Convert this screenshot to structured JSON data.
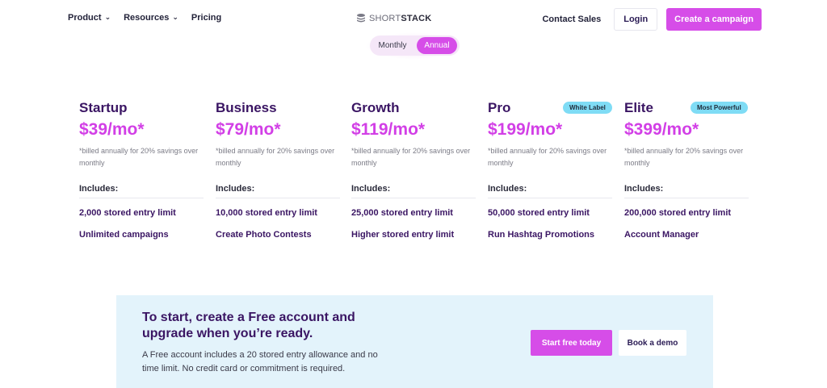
{
  "nav": {
    "left_links": [
      {
        "label": "Product",
        "dropdown": true
      },
      {
        "label": "Resources",
        "dropdown": true
      },
      {
        "label": "Pricing",
        "dropdown": false
      }
    ],
    "logo": {
      "part1": "SHORT",
      "part2": "STACK",
      "icon": "stack-logo-icon"
    },
    "contact_label": "Contact Sales",
    "login_label": "Login",
    "create_label": "Create a campaign"
  },
  "billing_toggle": {
    "options": [
      "Monthly",
      "Annual"
    ],
    "selected": "Annual"
  },
  "plans": [
    {
      "name": "Startup",
      "badge": "",
      "price": "$39/mo*",
      "billed_note": "*billed annually for 20% savings over monthly",
      "includes_label": "Includes:",
      "features": [
        "2,000 stored entry limit",
        "Unlimited campaigns"
      ]
    },
    {
      "name": "Business",
      "badge": "",
      "price": "$79/mo*",
      "billed_note": "*billed annually for 20% savings over monthly",
      "includes_label": "Includes:",
      "features": [
        "10,000 stored entry limit",
        "Create Photo Contests"
      ]
    },
    {
      "name": "Growth",
      "badge": "",
      "price": "$119/mo*",
      "billed_note": "*billed annually for 20% savings over monthly",
      "includes_label": "Includes:",
      "features": [
        "25,000 stored entry limit",
        "Higher stored entry limit"
      ]
    },
    {
      "name": "Pro",
      "badge": "White Label",
      "price": "$199/mo*",
      "billed_note": "*billed annually for 20% savings over monthly",
      "includes_label": "Includes:",
      "features": [
        "50,000 stored entry limit",
        "Run Hashtag Promotions"
      ]
    },
    {
      "name": "Elite",
      "badge": "Most Powerful",
      "price": "$399/mo*",
      "billed_note": "*billed annually for 20% savings over monthly",
      "includes_label": "Includes:",
      "features": [
        "200,000 stored entry limit",
        "Account Manager"
      ]
    }
  ],
  "cta": {
    "title": "To start, create a Free account and upgrade when you’re ready.",
    "description": "A Free account includes a 20 stored entry allowance and no time limit. No credit card or commitment is required.",
    "start_label": "Start free today",
    "demo_label": "Book a demo"
  },
  "colors": {
    "accent": "#d64de8",
    "heading": "#3a1563",
    "badge": "#7fdcf5",
    "banner_bg": "#e3f3fb"
  }
}
